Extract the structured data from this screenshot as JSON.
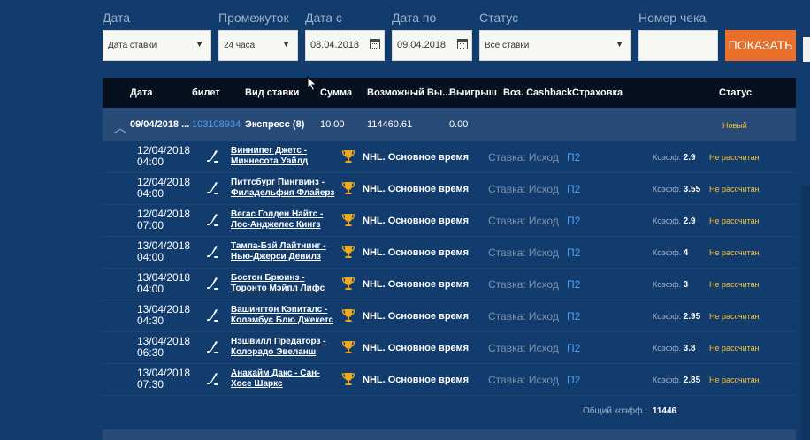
{
  "filters": {
    "date_label": "Дата",
    "date_value": "Дата ставки",
    "period_label": "Промежуток",
    "period_value": "24 часа",
    "date_from_label": "Дата с",
    "date_from_value": "08.04.2018",
    "date_to_label": "Дата по",
    "date_to_value": "09.04.2018",
    "status_label": "Статус",
    "status_value": "Все ставки",
    "check_label": "Номер чека",
    "check_value": "",
    "show_button": "ПОКАЗАТЬ"
  },
  "table": {
    "headers": [
      "Дата",
      "билет",
      "Вид ставки",
      "Сумма",
      "Возможный Вы...",
      "Выигрыш",
      "Воз. Cashback",
      "Страховка",
      "Статус"
    ]
  },
  "summary": {
    "date": "09/04/2018 ...",
    "ticket": "103108934",
    "type": "Экспресс (8)",
    "sum": "10.00",
    "possible": "114460.61",
    "win": "0.00",
    "status": "Новый"
  },
  "events": [
    {
      "date": "12/04/2018",
      "time": "04:00",
      "match": "Виннипег Джетс - Миннесота Уайлд",
      "league": "NHL. Основное время",
      "bet": "Ставка: Исход",
      "outcome": "П2",
      "koef_label": "Коэфф.",
      "koef": "2.9",
      "status": "Не рассчитан"
    },
    {
      "date": "12/04/2018",
      "time": "04:00",
      "match": "Питтсбург Пингвинз - Филадельфия Флайерз",
      "league": "NHL. Основное время",
      "bet": "Ставка: Исход",
      "outcome": "П2",
      "koef_label": "Коэфф.",
      "koef": "3.55",
      "status": "Не рассчитан"
    },
    {
      "date": "12/04/2018",
      "time": "07:00",
      "match": "Вегас Голден Найтс - Лос-Анджелес Кингз",
      "league": "NHL. Основное время",
      "bet": "Ставка: Исход",
      "outcome": "П2",
      "koef_label": "Коэфф.",
      "koef": "2.9",
      "status": "Не рассчитан"
    },
    {
      "date": "13/04/2018",
      "time": "04:00",
      "match": "Тампа-Бэй Лайтнинг - Нью-Джерси Девилз",
      "league": "NHL. Основное время",
      "bet": "Ставка: Исход",
      "outcome": "П2",
      "koef_label": "Коэфф.",
      "koef": "4",
      "status": "Не рассчитан"
    },
    {
      "date": "13/04/2018",
      "time": "04:00",
      "match": "Бостон Брюинз - Торонто Мэйпл Лифс",
      "league": "NHL. Основное время",
      "bet": "Ставка: Исход",
      "outcome": "П2",
      "koef_label": "Коэфф.",
      "koef": "3",
      "status": "Не рассчитан"
    },
    {
      "date": "13/04/2018",
      "time": "04:30",
      "match": "Вашингтон Кэпиталс - Коламбус Блю Джекетс",
      "league": "NHL. Основное время",
      "bet": "Ставка: Исход",
      "outcome": "П2",
      "koef_label": "Коэфф.",
      "koef": "2.95",
      "status": "Не рассчитан"
    },
    {
      "date": "13/04/2018",
      "time": "06:30",
      "match": "Нэшвилл Предаторз - Колорадо Эвеланш",
      "league": "NHL. Основное время",
      "bet": "Ставка: Исход",
      "outcome": "П2",
      "koef_label": "Коэфф.",
      "koef": "3.8",
      "status": "Не рассчитан"
    },
    {
      "date": "13/04/2018",
      "time": "07:30",
      "match": "Анахайм Дакс - Сан-Хосе Шаркс",
      "league": "NHL. Основное время",
      "bet": "Ставка: Исход",
      "outcome": "П2",
      "koef_label": "Коэфф.",
      "koef": "2.85",
      "status": "Не рассчитан"
    }
  ],
  "total": {
    "label": "Общий коэфф.:",
    "value": "11446"
  },
  "colors": {
    "background": "#123b6e",
    "header": "#06101e",
    "accent_orange": "#e8702a",
    "link_blue": "#4f9ff0",
    "status_yellow": "#f7c234"
  },
  "icons": {
    "sport": "hockey-stick-icon",
    "league": "trophy-icon",
    "calendar": "calendar-icon",
    "dropdown": "chevron-down-icon",
    "collapse": "chevron-up-icon",
    "cursor": "mouse-pointer-icon"
  }
}
